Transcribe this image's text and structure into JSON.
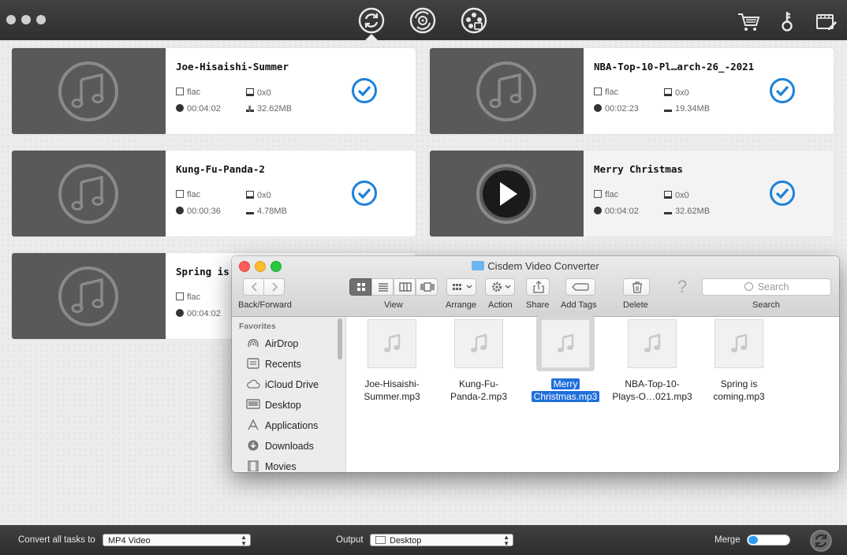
{
  "toolbar": {
    "modes": [
      "convert-mode-icon",
      "burn-mode-icon",
      "film-reel-icon"
    ],
    "right_icons": [
      "cart-icon",
      "key-icon",
      "video-edit-icon"
    ]
  },
  "tasks": [
    {
      "title": "Joe-Hisaishi-Summer",
      "format": "flac",
      "resolution": "0x0",
      "duration": "00:04:02",
      "size": "32.62MB"
    },
    {
      "title": "NBA-Top-10-Pl…arch-26_-2021",
      "format": "flac",
      "resolution": "0x0",
      "duration": "00:02:23",
      "size": "19.34MB"
    },
    {
      "title": "Kung-Fu-Panda-2",
      "format": "flac",
      "resolution": "0x0",
      "duration": "00:00:36",
      "size": "4.78MB"
    },
    {
      "title": "Merry Christmas",
      "format": "flac",
      "resolution": "0x0",
      "duration": "00:04:02",
      "size": "32.62MB"
    },
    {
      "title": "Spring is",
      "format": "flac",
      "duration": "00:04:02"
    }
  ],
  "bottom": {
    "convert_label": "Convert all tasks to",
    "convert_value": "MP4 Video",
    "output_label": "Output",
    "output_value": "Desktop",
    "merge_label": "Merge"
  },
  "finder": {
    "title": "Cisdem Video Converter",
    "labels": {
      "back_forward": "Back/Forward",
      "view": "View",
      "arrange": "Arrange",
      "action": "Action",
      "share": "Share",
      "add_tags": "Add Tags",
      "delete": "Delete",
      "search": "Search"
    },
    "search_placeholder": "Search",
    "sidebar_heading": "Favorites",
    "sidebar_items": [
      "AirDrop",
      "Recents",
      "iCloud Drive",
      "Desktop",
      "Applications",
      "Downloads",
      "Movies"
    ],
    "files": [
      {
        "line1": "Joe-Hisaishi-",
        "line2": "Summer.mp3"
      },
      {
        "line1": "Kung-Fu-",
        "line2": "Panda-2.mp3"
      },
      {
        "line1": "Merry",
        "line2": "Christmas.mp3"
      },
      {
        "line1": "NBA-Top-10-",
        "line2": "Plays-O…021.mp3"
      },
      {
        "line1": "Spring is",
        "line2": "coming.mp3"
      }
    ]
  }
}
